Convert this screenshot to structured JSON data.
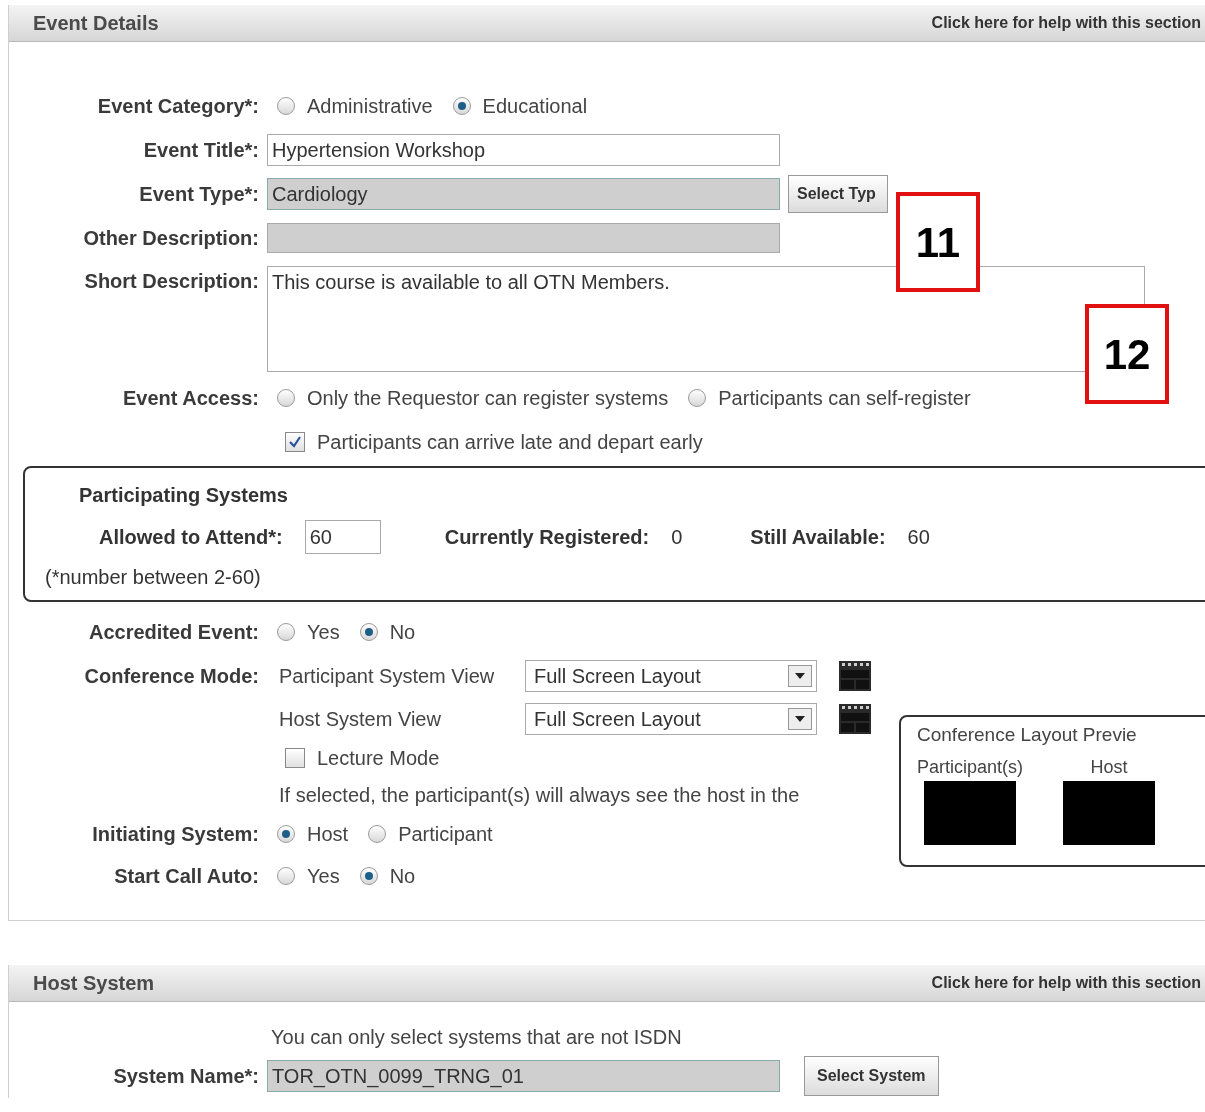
{
  "event_details": {
    "title": "Event Details",
    "help_link": "Click here for help with this section",
    "category": {
      "label": "Event Category*:",
      "options": [
        {
          "label": "Administrative",
          "selected": false
        },
        {
          "label": "Educational",
          "selected": true
        }
      ]
    },
    "event_title": {
      "label": "Event Title*:",
      "value": "Hypertension Workshop"
    },
    "event_type": {
      "label": "Event Type*:",
      "value": "Cardiology",
      "button": "Select Typ"
    },
    "other_description": {
      "label": "Other Description:"
    },
    "short_description": {
      "label": "Short Description:",
      "value": "This course is available to all OTN Members."
    },
    "access": {
      "label": "Event Access:",
      "options": [
        {
          "label": "Only the Requestor can register systems",
          "selected": false
        },
        {
          "label": "Participants can self-register",
          "selected": false
        }
      ],
      "late_arrival": {
        "label": "Participants can arrive late and depart early",
        "checked": true
      }
    },
    "participating": {
      "title": "Participating Systems",
      "allowed_label": "Allowed to Attend*:",
      "allowed_value": "60",
      "registered_label": "Currently Registered:",
      "registered_value": "0",
      "available_label": "Still Available:",
      "available_value": "60",
      "hint": "(*number between 2-60)"
    },
    "accredited": {
      "label": "Accredited Event:",
      "options": [
        {
          "label": "Yes",
          "selected": false
        },
        {
          "label": "No",
          "selected": true
        }
      ]
    },
    "conference_mode": {
      "label": "Conference Mode:",
      "views": [
        {
          "label": "Participant System View",
          "value": "Full Screen Layout"
        },
        {
          "label": "Host System View",
          "value": "Full Screen Layout"
        }
      ],
      "lecture_mode": {
        "label": "Lecture Mode",
        "checked": false
      },
      "note": "If selected, the participant(s) will always see the host in the"
    },
    "preview": {
      "title": "Conference Layout Previe",
      "panes": [
        "Participant(s)",
        "Host"
      ]
    },
    "initiating": {
      "label": "Initiating System:",
      "options": [
        {
          "label": "Host",
          "selected": true
        },
        {
          "label": "Participant",
          "selected": false
        }
      ]
    },
    "start_call": {
      "label": "Start Call Auto:",
      "options": [
        {
          "label": "Yes",
          "selected": false
        },
        {
          "label": "No",
          "selected": true
        }
      ]
    }
  },
  "host_system": {
    "title": "Host System",
    "help_link": "Click here for help with this section",
    "note": "You can only select systems that are not ISDN",
    "system_name": {
      "label": "System Name*:",
      "value": "TOR_OTN_0099_TRNG_01",
      "button": "Select System"
    }
  },
  "callouts": [
    "11",
    "12"
  ]
}
